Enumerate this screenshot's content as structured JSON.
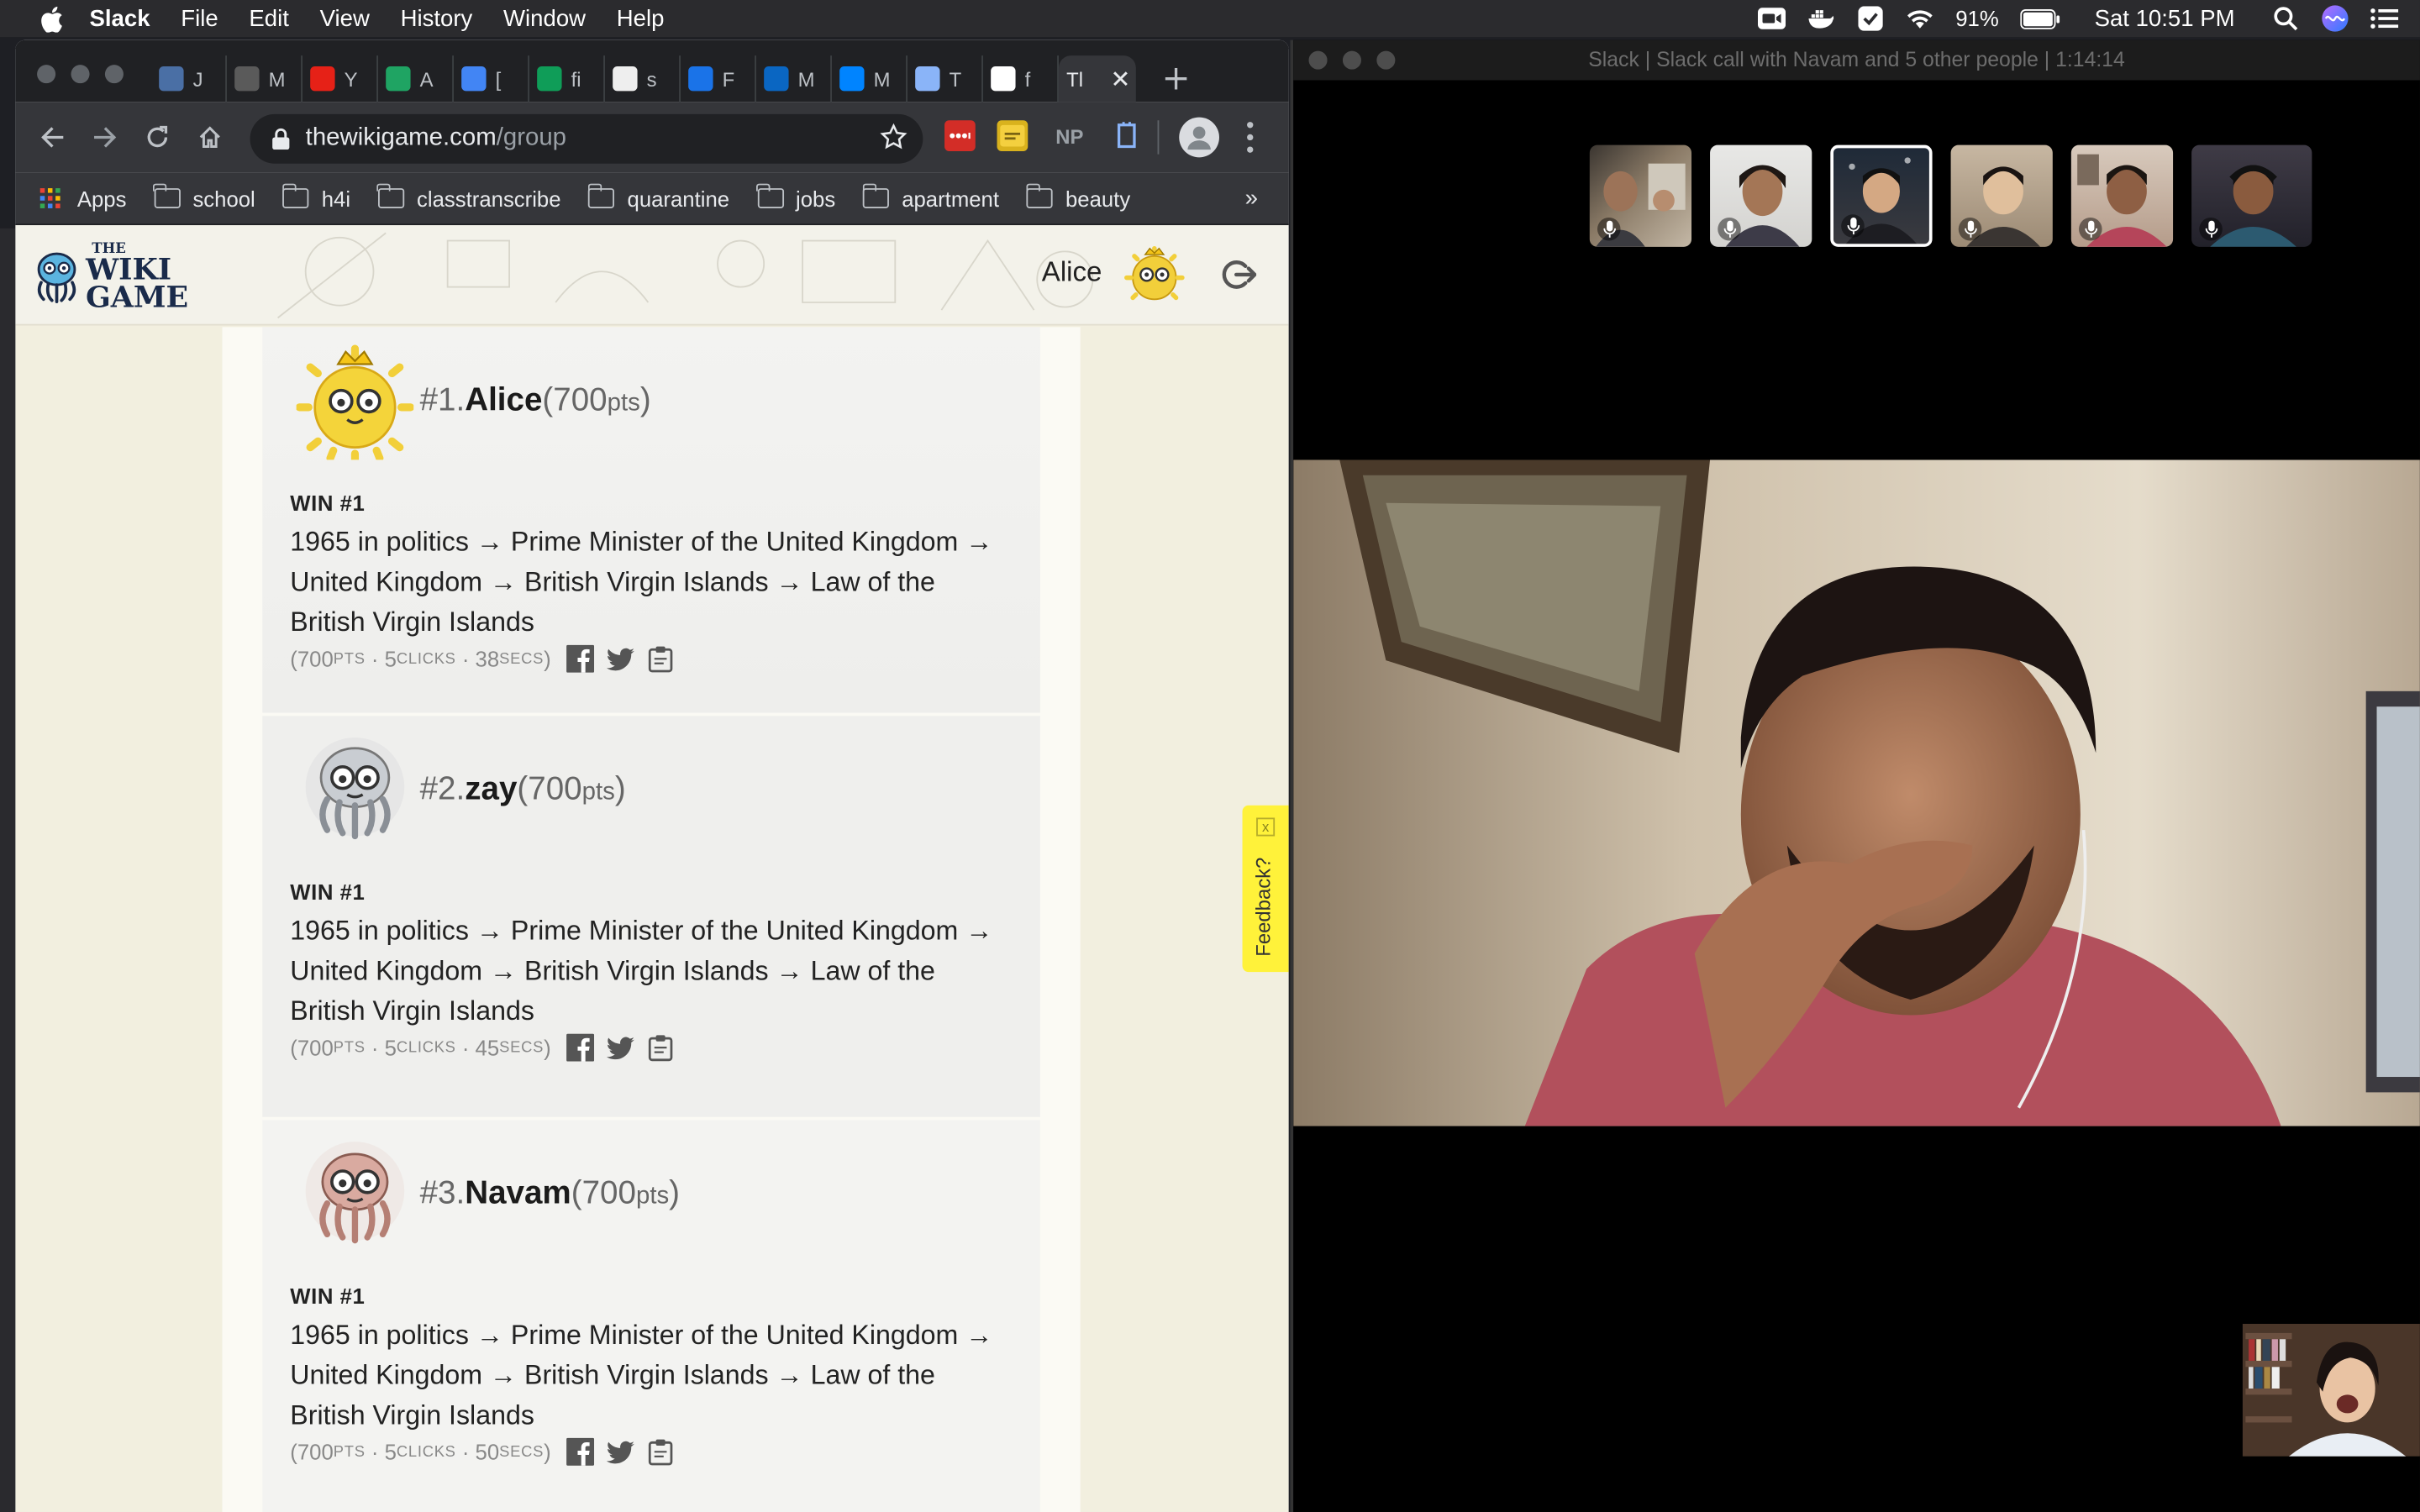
{
  "menubar": {
    "app": "Slack",
    "items": [
      "File",
      "Edit",
      "View",
      "History",
      "Window",
      "Help"
    ],
    "battery": "91%",
    "clock": "Sat 10:51 PM"
  },
  "browser": {
    "tabs": [
      {
        "label": "J",
        "icon": "m-icon",
        "color": "#4a6fa5"
      },
      {
        "label": "M",
        "icon": "github-icon",
        "color": "#5a5a5a"
      },
      {
        "label": "Y",
        "icon": "youtube-icon",
        "color": "#e62117"
      },
      {
        "label": "A",
        "icon": "drive-icon",
        "color": "#1fa463"
      },
      {
        "label": "[",
        "icon": "docs-icon",
        "color": "#4285f4"
      },
      {
        "label": "fi",
        "icon": "sheets-icon",
        "color": "#0f9d58"
      },
      {
        "label": "s",
        "icon": "trello-icon",
        "color": "#eeeeee"
      },
      {
        "label": "F",
        "icon": "chart-icon",
        "color": "#1a73e8"
      },
      {
        "label": "M",
        "icon": "linkedin-icon",
        "color": "#0a66c2"
      },
      {
        "label": "M",
        "icon": "messenger-icon",
        "color": "#0084ff"
      },
      {
        "label": "T",
        "icon": "wikigame-icon",
        "color": "#8ab4f8"
      },
      {
        "label": "f",
        "icon": "google-icon",
        "color": "#ffffff"
      },
      {
        "label": "Tl",
        "icon": "",
        "color": ""
      }
    ],
    "url_host": "thewikigame.com",
    "url_path": "/group",
    "extensions": [
      "lastpass-icon",
      "notes-icon",
      "NP",
      "extension-icon"
    ],
    "bookmarks": [
      "Apps",
      "school",
      "h4i",
      "classtranscribe",
      "quarantine",
      "jobs",
      "apartment",
      "beauty"
    ],
    "overflow": "»"
  },
  "site": {
    "logo_the": "THE",
    "logo_word1": "WIKI",
    "logo_word2": "GAME",
    "user_name": "Alice",
    "feedback": "Feedback?",
    "feedback_close": "x"
  },
  "leaderboard": [
    {
      "rank": "#1.",
      "name": "Alice",
      "points": "700",
      "win": "WIN #1",
      "path": "1965 in politics → Prime Minister of the United Kingdom → United Kingdom → British Virgin Islands → Law of the British Virgin Islands",
      "stat_pts": "700",
      "stat_clicks": "5",
      "stat_secs": "38"
    },
    {
      "rank": "#2.",
      "name": "zay",
      "points": "700",
      "win": "WIN #1",
      "path": "1965 in politics → Prime Minister of the United Kingdom → United Kingdom → British Virgin Islands → Law of the British Virgin Islands",
      "stat_pts": "700",
      "stat_clicks": "5",
      "stat_secs": "45"
    },
    {
      "rank": "#3.",
      "name": "Navam",
      "points": "700",
      "win": "WIN #1",
      "path": "1965 in politics → Prime Minister of the United Kingdom → United Kingdom → British Virgin Islands → Law of the British Virgin Islands",
      "stat_pts": "700",
      "stat_clicks": "5",
      "stat_secs": "50"
    }
  ],
  "labels": {
    "pts_open": "(",
    "pts_unit": "pts",
    "pts_close": ")",
    "stat_open": "(",
    "stat_pts_unit": "PTS",
    "stat_clicks_unit": "CLICKS",
    "stat_secs_unit": "SECS",
    "stat_close": ")",
    "sep": "·"
  },
  "call": {
    "title": "Slack | Slack call with Navam and 5 other people | 1:14:14",
    "participants": 6
  },
  "colors": {
    "accent_yellow": "#fff23a",
    "page_bg": "#f2efdf",
    "chrome_dark": "#35363a"
  }
}
